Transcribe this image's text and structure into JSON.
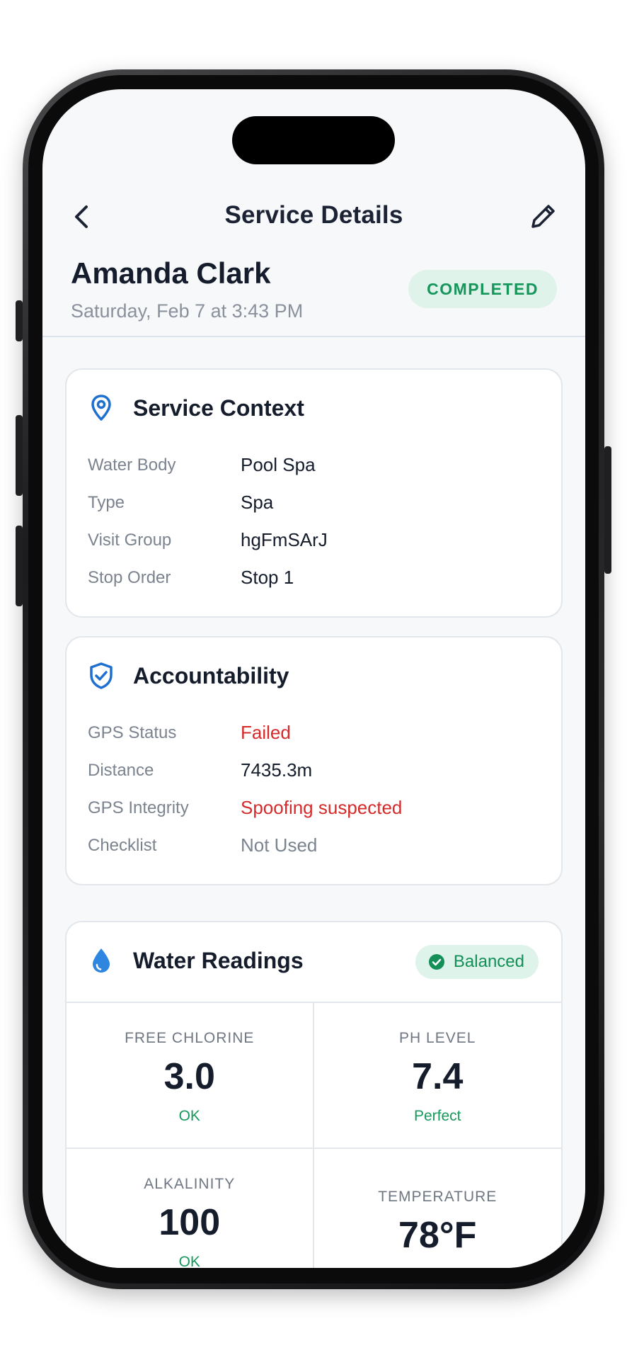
{
  "nav": {
    "title": "Service Details",
    "back_icon": "chevron-left-icon",
    "edit_icon": "pencil-icon"
  },
  "header": {
    "customer_name": "Amanda Clark",
    "date": "Saturday, Feb 7 at 3:43 PM",
    "status": "COMPLETED"
  },
  "service_context": {
    "title": "Service Context",
    "icon": "map-pin-icon",
    "rows": [
      {
        "label": "Water Body",
        "value": "Pool Spa"
      },
      {
        "label": "Type",
        "value": "Spa"
      },
      {
        "label": "Visit Group",
        "value": "hgFmSArJ"
      },
      {
        "label": "Stop Order",
        "value": "Stop 1"
      }
    ]
  },
  "accountability": {
    "title": "Accountability",
    "icon": "shield-check-icon",
    "rows": [
      {
        "label": "GPS Status",
        "value": "Failed"
      },
      {
        "label": "Distance",
        "value": "7435.3m"
      },
      {
        "label": "GPS Integrity",
        "value": "Spoofing suspected"
      },
      {
        "label": "Checklist",
        "value": "Not Used"
      }
    ]
  },
  "water_readings": {
    "title": "Water Readings",
    "icon": "water-drop-icon",
    "badge": "Balanced",
    "badge_icon": "check-circle-icon",
    "readings": [
      {
        "label": "FREE CHLORINE",
        "value": "3.0",
        "status": "OK"
      },
      {
        "label": "PH LEVEL",
        "value": "7.4",
        "status": "Perfect"
      },
      {
        "label": "ALKALINITY",
        "value": "100",
        "status": "OK"
      },
      {
        "label": "TEMPERATURE",
        "value": "78°F",
        "status": ""
      }
    ]
  },
  "colors": {
    "success": "#15965b",
    "danger": "#d62a2a",
    "accent": "#1f6fd1",
    "background": "#f6f8fa"
  }
}
